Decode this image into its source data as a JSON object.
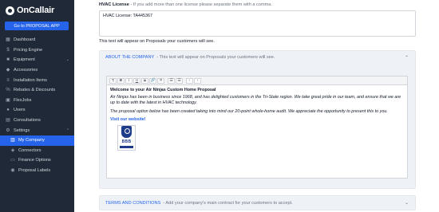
{
  "brand": {
    "name": "OnCallair"
  },
  "sidebar": {
    "proposal_button": "Go to PROPOSAL APP",
    "items": [
      {
        "label": "Dashboard",
        "icon": "grid-icon"
      },
      {
        "label": "Pricing Engine",
        "icon": "dollar-icon"
      },
      {
        "label": "Equipment",
        "icon": "box-icon",
        "expandable": true
      },
      {
        "label": "Accessories",
        "icon": "tag-icon"
      },
      {
        "label": "Installation Items",
        "icon": "list-icon"
      },
      {
        "label": "Rebates & Discounts",
        "icon": "percent-icon"
      },
      {
        "label": "FlexJobs",
        "icon": "briefcase-icon"
      },
      {
        "label": "Users",
        "icon": "users-icon"
      },
      {
        "label": "Consultations",
        "icon": "calendar-icon"
      },
      {
        "label": "Settings",
        "icon": "gear-icon",
        "expandable": true,
        "expanded": true
      }
    ],
    "settings_subitems": [
      {
        "label": "My Company",
        "icon": "building-icon",
        "active": true
      },
      {
        "label": "Connectors",
        "icon": "plug-icon"
      },
      {
        "label": "Finance Options",
        "icon": "card-icon"
      },
      {
        "label": "Proposal Labels",
        "icon": "label-icon"
      }
    ]
  },
  "hvac": {
    "label": "HVAC License",
    "hint": "- If you add more than one license please separate them with a comma.",
    "value": "HVAC License: TA445367",
    "helper": "This text will appear on Proposals your customers will see."
  },
  "about": {
    "title": "ABOUT THE COMPANY",
    "hint": "- This text will appear on Proposals your customers will see.",
    "toolbar": [
      "¶",
      "B",
      "I",
      "U",
      "S",
      "🔗",
      "✕",
      "☰",
      "☰",
      "‹",
      "›"
    ],
    "heading": "Welcome to your Air Ninjas Custom Home Proposal",
    "paragraph1": "Air Ninjas has been in business since 1968, and has delighted customers in the Tri-State region. We take great pride in our team, and ensure that we are up to date with the latest in HVAC technology.",
    "paragraph2": "The proposal option below has been created taking into mind our 20-point whole-home audit. We appreciate the opportunity to present this to you.",
    "link": "Visit our website!",
    "badge_text": "BBB"
  },
  "terms": {
    "title": "TERMS AND CONDITIONS",
    "hint": "- Add your company's main contract for your customers to accept."
  },
  "colors": {
    "sidebar_bg": "#1f2937",
    "accent": "#2563eb",
    "section_bg": "#eef2f7"
  }
}
